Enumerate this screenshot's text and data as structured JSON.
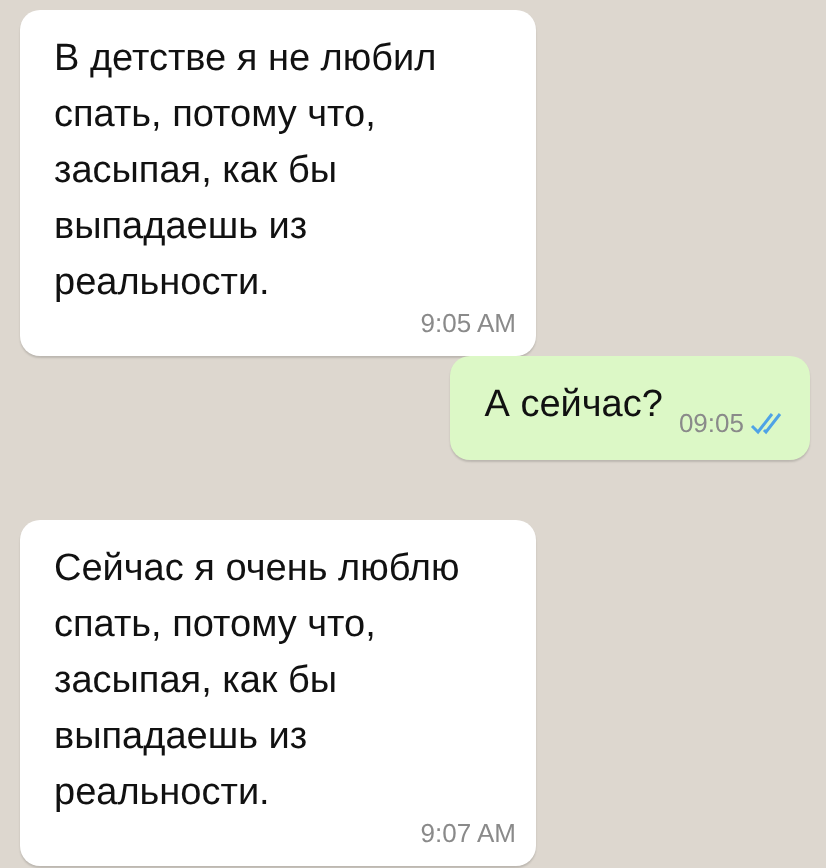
{
  "messages": [
    {
      "kind": "incoming",
      "text": "В детстве я не любил спать, потому что, засыпая, как бы выпадаешь из реальности.",
      "time": "9:05 AM"
    },
    {
      "kind": "outgoing",
      "text": "А сейчас?",
      "time": "09:05",
      "read": true
    },
    {
      "kind": "incoming",
      "text": "Сейчас я очень люблю спать, потому что, засыпая, как бы выпадаешь из реальности.",
      "time": "9:07 AM"
    }
  ]
}
